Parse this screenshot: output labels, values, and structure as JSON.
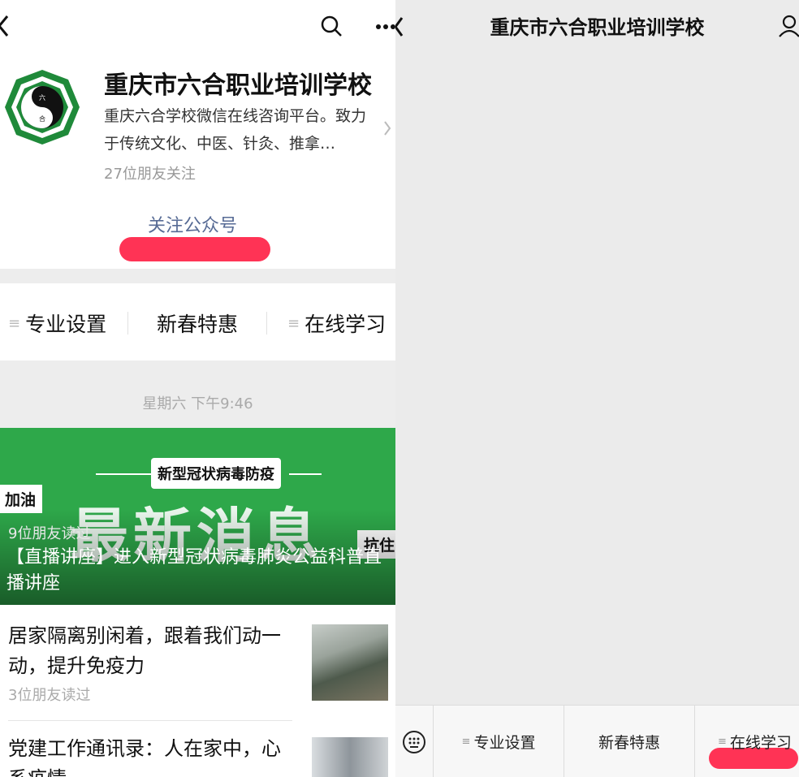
{
  "left": {
    "account": {
      "name": "重庆市六合职业培训学校",
      "description": "重庆六合学校微信在线咨询平台。致力于传统文化、中医、针灸、推拿…",
      "friends_following": "27位朋友关注",
      "follow_label": "关注公众号",
      "logo_text": [
        "六",
        "合"
      ]
    },
    "menu": [
      "专业设置",
      "新春特惠",
      "在线学习"
    ],
    "date_label": "星期六 下午9:46",
    "banner": {
      "tag": "新型冠状病毒防疫",
      "headline": "最新消息",
      "side_left": "加油",
      "side_right": "抗住",
      "readers": "9位朋友读过",
      "title": "【直播讲座】进入新型冠状病毒肺炎公益科普直播讲座"
    },
    "articles": [
      {
        "title": "居家隔离别闲着，跟着我们动一动，提升免疫力",
        "meta": "3位朋友读过"
      },
      {
        "title": "党建工作通讯录：人在家中，心系疫情",
        "meta": ""
      }
    ]
  },
  "right": {
    "title": "重庆市六合职业培训学校",
    "menu": [
      "专业设置",
      "新春特惠",
      "在线学习"
    ]
  },
  "colors": {
    "link": "#576b95",
    "banner_green": "#2ea84a",
    "highlight_red": "#ff3355",
    "logo_green": "#1f8a3a"
  }
}
